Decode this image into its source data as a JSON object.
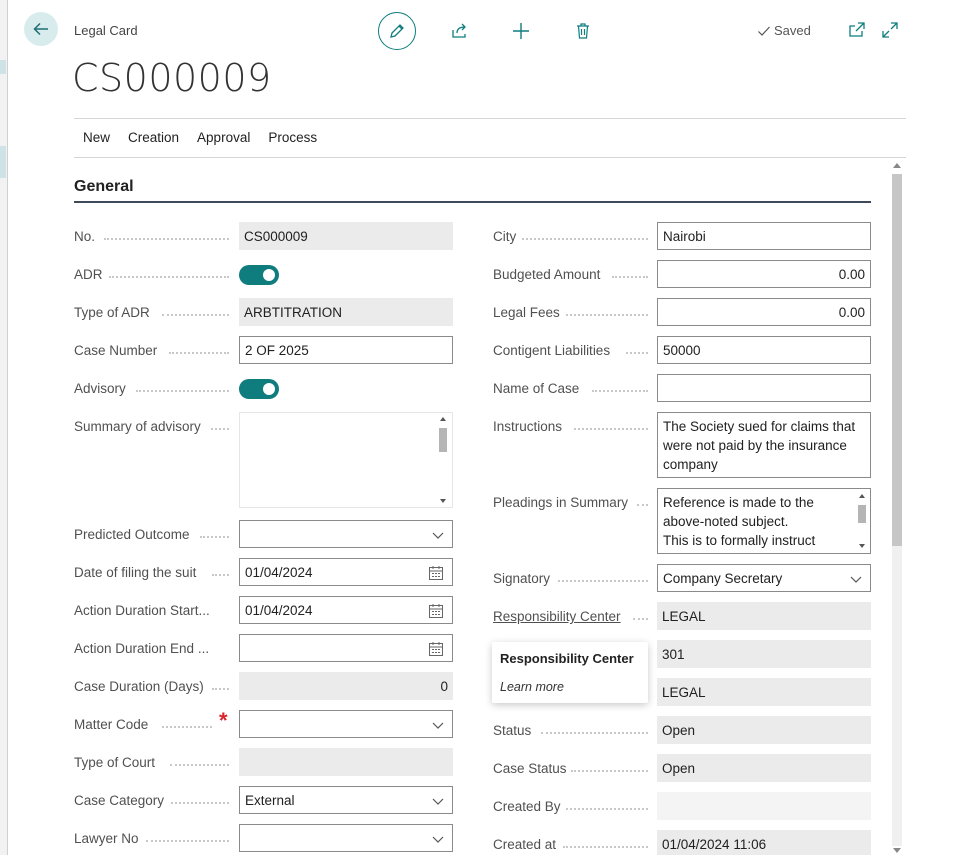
{
  "header": {
    "breadcrumb": "Legal Card",
    "title": "CS000009",
    "status": "Saved"
  },
  "icons": {
    "back": "arrow-left-icon",
    "edit": "pencil-icon",
    "share": "share-icon",
    "add": "plus-icon",
    "delete": "trash-icon",
    "saved": "check-icon",
    "open_new": "open-in-new-window-icon",
    "expand": "expand-icon",
    "dropdown": "chevron-down-icon",
    "calendar": "calendar-icon"
  },
  "actions": [
    "New",
    "Creation",
    "Approval",
    "Process"
  ],
  "section": {
    "title": "General"
  },
  "left_fields": {
    "no": {
      "label": "No.",
      "value": "CS000009"
    },
    "adr": {
      "label": "ADR",
      "value": true
    },
    "type_of_adr": {
      "label": "Type of ADR",
      "value": "ARBTITRATION"
    },
    "case_number": {
      "label": "Case Number",
      "value": "2 OF 2025"
    },
    "advisory": {
      "label": "Advisory",
      "value": true
    },
    "summary_of_advisory": {
      "label": "Summary of advisory",
      "value": ""
    },
    "predicted_outcome": {
      "label": "Predicted Outcome",
      "value": ""
    },
    "date_of_filing": {
      "label": "Date of filing the suit",
      "value": "01/04/2024"
    },
    "action_duration_start": {
      "label": "Action Duration Start...",
      "value": "01/04/2024"
    },
    "action_duration_end": {
      "label": "Action Duration End ...",
      "value": ""
    },
    "case_duration": {
      "label": "Case Duration (Days)",
      "value": "0"
    },
    "matter_code": {
      "label": "Matter Code",
      "value": "",
      "required_mark": "*"
    },
    "type_of_court": {
      "label": "Type of Court",
      "value": ""
    },
    "case_category": {
      "label": "Case Category",
      "value": "External"
    },
    "lawyer_no": {
      "label": "Lawyer No",
      "value": ""
    }
  },
  "right_fields": {
    "city": {
      "label": "City",
      "value": "Nairobi"
    },
    "budgeted_amount": {
      "label": "Budgeted Amount",
      "value": "0.00"
    },
    "legal_fees": {
      "label": "Legal Fees",
      "value": "0.00"
    },
    "contigent_liabilities": {
      "label": "Contigent Liabilities",
      "value": "50000"
    },
    "name_of_case": {
      "label": "Name of Case",
      "value": ""
    },
    "instructions": {
      "label": "Instructions",
      "line1": "The Society sued for claims that",
      "line2": "were not paid by the insurance",
      "line3": "company"
    },
    "pleadings_in_summary": {
      "label": "Pleadings in Summary",
      "line1": "Reference is made to the",
      "line2": "above-noted subject.",
      "line3": "This is to formally instruct"
    },
    "signatory": {
      "label": "Signatory",
      "value": "Company Secretary"
    },
    "responsibility_center": {
      "label": "Responsibility Center",
      "value": "LEGAL"
    },
    "hidden_field_1": {
      "value": "301"
    },
    "hidden_field_2": {
      "value": "LEGAL"
    },
    "status": {
      "label": "Status",
      "value": "Open"
    },
    "case_status": {
      "label": "Case Status",
      "value": "Open"
    },
    "created_by": {
      "label": "Created By",
      "value": ""
    },
    "created_at": {
      "label": "Created at",
      "value": "01/04/2024 11:06"
    }
  },
  "tooltip": {
    "title": "Responsibility Center",
    "link": "Learn more"
  },
  "colors": {
    "accent": "#0f7d7e",
    "required": "#d9262c",
    "readonly_bg": "#ebebeb"
  }
}
